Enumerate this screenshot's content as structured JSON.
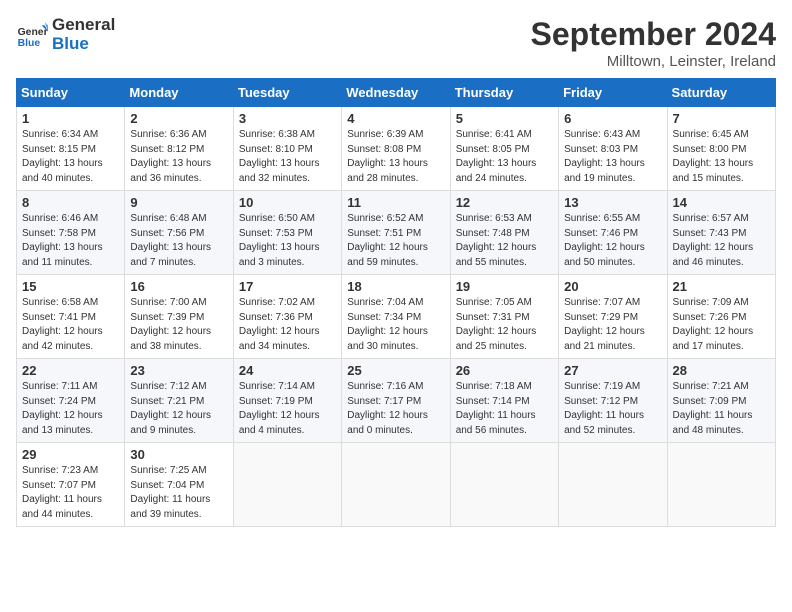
{
  "header": {
    "logo_line1": "General",
    "logo_line2": "Blue",
    "month_title": "September 2024",
    "location": "Milltown, Leinster, Ireland"
  },
  "weekdays": [
    "Sunday",
    "Monday",
    "Tuesday",
    "Wednesday",
    "Thursday",
    "Friday",
    "Saturday"
  ],
  "weeks": [
    [
      {
        "day": "1",
        "info": "Sunrise: 6:34 AM\nSunset: 8:15 PM\nDaylight: 13 hours\nand 40 minutes."
      },
      {
        "day": "2",
        "info": "Sunrise: 6:36 AM\nSunset: 8:12 PM\nDaylight: 13 hours\nand 36 minutes."
      },
      {
        "day": "3",
        "info": "Sunrise: 6:38 AM\nSunset: 8:10 PM\nDaylight: 13 hours\nand 32 minutes."
      },
      {
        "day": "4",
        "info": "Sunrise: 6:39 AM\nSunset: 8:08 PM\nDaylight: 13 hours\nand 28 minutes."
      },
      {
        "day": "5",
        "info": "Sunrise: 6:41 AM\nSunset: 8:05 PM\nDaylight: 13 hours\nand 24 minutes."
      },
      {
        "day": "6",
        "info": "Sunrise: 6:43 AM\nSunset: 8:03 PM\nDaylight: 13 hours\nand 19 minutes."
      },
      {
        "day": "7",
        "info": "Sunrise: 6:45 AM\nSunset: 8:00 PM\nDaylight: 13 hours\nand 15 minutes."
      }
    ],
    [
      {
        "day": "8",
        "info": "Sunrise: 6:46 AM\nSunset: 7:58 PM\nDaylight: 13 hours\nand 11 minutes."
      },
      {
        "day": "9",
        "info": "Sunrise: 6:48 AM\nSunset: 7:56 PM\nDaylight: 13 hours\nand 7 minutes."
      },
      {
        "day": "10",
        "info": "Sunrise: 6:50 AM\nSunset: 7:53 PM\nDaylight: 13 hours\nand 3 minutes."
      },
      {
        "day": "11",
        "info": "Sunrise: 6:52 AM\nSunset: 7:51 PM\nDaylight: 12 hours\nand 59 minutes."
      },
      {
        "day": "12",
        "info": "Sunrise: 6:53 AM\nSunset: 7:48 PM\nDaylight: 12 hours\nand 55 minutes."
      },
      {
        "day": "13",
        "info": "Sunrise: 6:55 AM\nSunset: 7:46 PM\nDaylight: 12 hours\nand 50 minutes."
      },
      {
        "day": "14",
        "info": "Sunrise: 6:57 AM\nSunset: 7:43 PM\nDaylight: 12 hours\nand 46 minutes."
      }
    ],
    [
      {
        "day": "15",
        "info": "Sunrise: 6:58 AM\nSunset: 7:41 PM\nDaylight: 12 hours\nand 42 minutes."
      },
      {
        "day": "16",
        "info": "Sunrise: 7:00 AM\nSunset: 7:39 PM\nDaylight: 12 hours\nand 38 minutes."
      },
      {
        "day": "17",
        "info": "Sunrise: 7:02 AM\nSunset: 7:36 PM\nDaylight: 12 hours\nand 34 minutes."
      },
      {
        "day": "18",
        "info": "Sunrise: 7:04 AM\nSunset: 7:34 PM\nDaylight: 12 hours\nand 30 minutes."
      },
      {
        "day": "19",
        "info": "Sunrise: 7:05 AM\nSunset: 7:31 PM\nDaylight: 12 hours\nand 25 minutes."
      },
      {
        "day": "20",
        "info": "Sunrise: 7:07 AM\nSunset: 7:29 PM\nDaylight: 12 hours\nand 21 minutes."
      },
      {
        "day": "21",
        "info": "Sunrise: 7:09 AM\nSunset: 7:26 PM\nDaylight: 12 hours\nand 17 minutes."
      }
    ],
    [
      {
        "day": "22",
        "info": "Sunrise: 7:11 AM\nSunset: 7:24 PM\nDaylight: 12 hours\nand 13 minutes."
      },
      {
        "day": "23",
        "info": "Sunrise: 7:12 AM\nSunset: 7:21 PM\nDaylight: 12 hours\nand 9 minutes."
      },
      {
        "day": "24",
        "info": "Sunrise: 7:14 AM\nSunset: 7:19 PM\nDaylight: 12 hours\nand 4 minutes."
      },
      {
        "day": "25",
        "info": "Sunrise: 7:16 AM\nSunset: 7:17 PM\nDaylight: 12 hours\nand 0 minutes."
      },
      {
        "day": "26",
        "info": "Sunrise: 7:18 AM\nSunset: 7:14 PM\nDaylight: 11 hours\nand 56 minutes."
      },
      {
        "day": "27",
        "info": "Sunrise: 7:19 AM\nSunset: 7:12 PM\nDaylight: 11 hours\nand 52 minutes."
      },
      {
        "day": "28",
        "info": "Sunrise: 7:21 AM\nSunset: 7:09 PM\nDaylight: 11 hours\nand 48 minutes."
      }
    ],
    [
      {
        "day": "29",
        "info": "Sunrise: 7:23 AM\nSunset: 7:07 PM\nDaylight: 11 hours\nand 44 minutes."
      },
      {
        "day": "30",
        "info": "Sunrise: 7:25 AM\nSunset: 7:04 PM\nDaylight: 11 hours\nand 39 minutes."
      },
      {
        "day": "",
        "info": ""
      },
      {
        "day": "",
        "info": ""
      },
      {
        "day": "",
        "info": ""
      },
      {
        "day": "",
        "info": ""
      },
      {
        "day": "",
        "info": ""
      }
    ]
  ]
}
